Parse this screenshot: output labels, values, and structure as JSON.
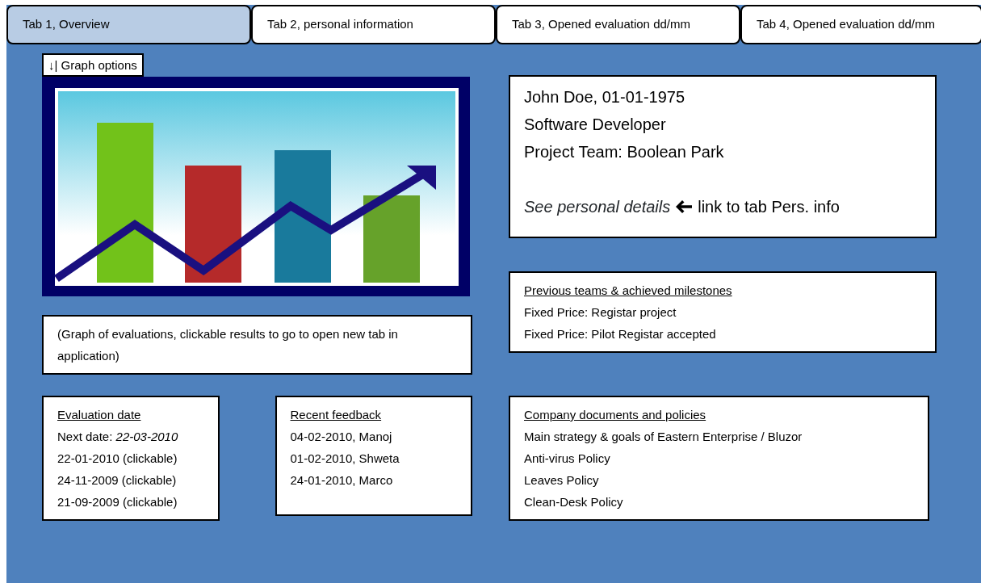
{
  "tabs": [
    {
      "label": "Tab 1, Overview",
      "selected": true
    },
    {
      "label": "Tab 2, personal information",
      "selected": false
    },
    {
      "label": "Tab 3, Opened evaluation dd/mm",
      "selected": false
    },
    {
      "label": "Tab 4, Opened evaluation dd/mm",
      "selected": false
    }
  ],
  "graph_options": {
    "label": "↓| Graph options"
  },
  "graph_note": "(Graph of evaluations, clickable results to go to open new tab in application)",
  "person": {
    "lines": [
      "John Doe, 01-01-1975",
      "Software Developer",
      "Project Team: Boolean Park"
    ],
    "link": "See personal details",
    "link_note": "link to tab Pers. info"
  },
  "milestones": {
    "title": "Previous teams & achieved milestones",
    "items": [
      "Fixed Price: Registar project",
      "Fixed Price: Pilot Registar accepted"
    ]
  },
  "evaluation": {
    "title": "Evaluation date",
    "next": "Next date: *22-03-2010*",
    "items": [
      "22-01-2010 (clickable)",
      "24-11-2009 (clickable)",
      "21-09-2009 (clickable)"
    ]
  },
  "feedback": {
    "title": "Recent feedback",
    "items": [
      "04-02-2010, Manoj",
      "01-02-2010, Shweta",
      "24-01-2010, Marco"
    ]
  },
  "documents": {
    "title": "Company documents and policies",
    "items": [
      "Main strategy & goals of Eastern Enterprise / Bluzor",
      "Anti-virus Policy",
      "Leaves Policy",
      "Clean-Desk Policy"
    ]
  }
}
